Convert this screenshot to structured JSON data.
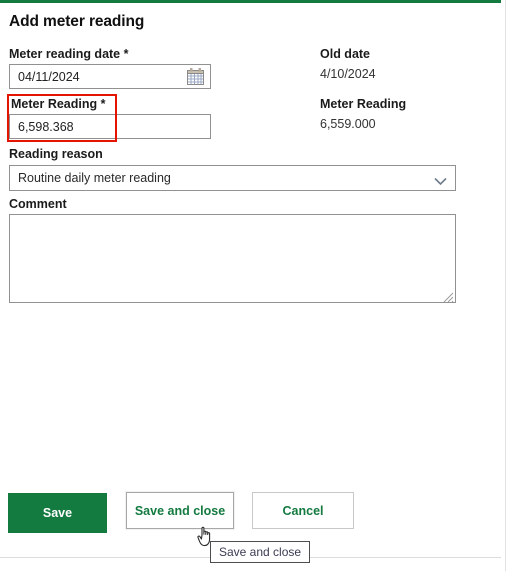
{
  "panel": {
    "title": "Add meter reading",
    "accent_color": "#137A40"
  },
  "form": {
    "meter_reading_date": {
      "label": "Meter reading date *",
      "value": "04/11/2024",
      "placeholder": "",
      "icon": "calendar-icon"
    },
    "meter_reading": {
      "label": "Meter Reading *",
      "value": "6,598.368",
      "placeholder": "",
      "highlight_color": "#E51400",
      "highlighted": "true"
    },
    "reading_reason": {
      "label": "Reading reason",
      "selected": "Routine daily meter reading",
      "icon": "chevron-down-icon",
      "options": [
        "Routine daily meter reading"
      ]
    },
    "comment": {
      "label": "Comment",
      "value": "",
      "placeholder": ""
    }
  },
  "readonly": {
    "old_date": {
      "label": "Old date",
      "value": "4/10/2024"
    },
    "old_meter_reading": {
      "label": "Meter Reading",
      "value": "6,559.000"
    }
  },
  "buttons": {
    "save": "Save",
    "save_and_close": "Save and close",
    "cancel": "Cancel"
  },
  "tooltip": {
    "text": "Save and close"
  }
}
